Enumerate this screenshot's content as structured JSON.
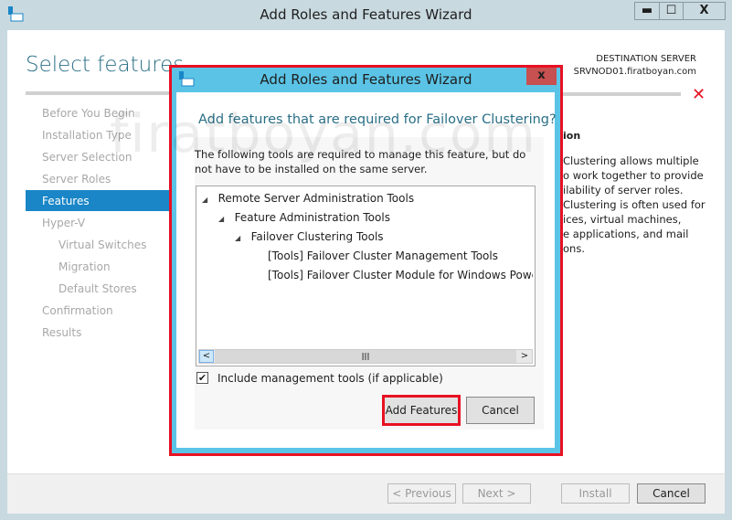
{
  "window": {
    "title": "Add Roles and Features Wizard",
    "minimize": "▬",
    "maximize": "☐",
    "close": "X"
  },
  "page": {
    "heading": "Select features",
    "dest_label": "DESTINATION SERVER",
    "dest_server": "SRVNOD01.firatboyan.com"
  },
  "nav": [
    "Before You Begin",
    "Installation Type",
    "Server Selection",
    "Server Roles",
    "Features",
    "Hyper-V",
    "Virtual Switches",
    "Migration",
    "Default Stores",
    "Confirmation",
    "Results"
  ],
  "description": {
    "heading": "ion",
    "lines": [
      "Clustering allows multiple",
      "o work together to provide",
      "ilability of server roles.",
      "Clustering is often used for",
      "ices, virtual machines,",
      "e applications, and mail",
      "ons."
    ]
  },
  "footer": {
    "previous": "< Previous",
    "next": "Next >",
    "install": "Install",
    "cancel": "Cancel"
  },
  "dialog": {
    "title": "Add Roles and Features Wizard",
    "close": "x",
    "heading": "Add features that are required for Failover Clustering?",
    "body": "The following tools are required to manage this feature, but do not have to be installed on the same server.",
    "tree": [
      "Remote Server Administration Tools",
      "Feature Administration Tools",
      "Failover Clustering Tools",
      "[Tools] Failover Cluster Management Tools",
      "[Tools] Failover Cluster Module for Windows PowerShe"
    ],
    "checkbox_label": "Include management tools (if applicable)",
    "checkbox_checked": true,
    "add_button": "Add Features",
    "cancel_button": "Cancel"
  },
  "watermark": "firatboyan.com",
  "colors": {
    "accent": "#1a86c7",
    "dialog_border": "#5bc4e6",
    "highlight": "#e81123"
  }
}
